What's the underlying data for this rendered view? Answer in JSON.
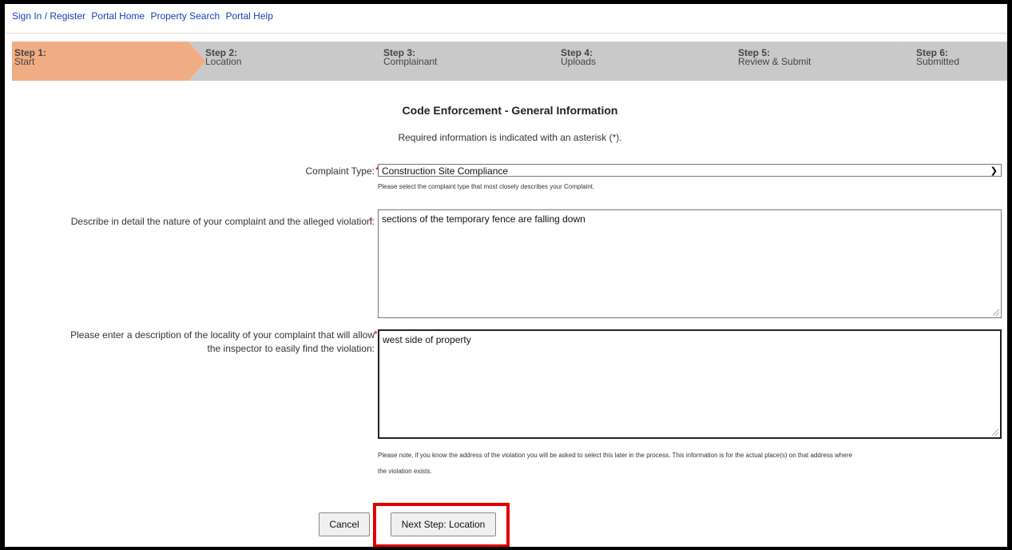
{
  "nav": {
    "links": [
      "Sign In / Register",
      "Portal Home",
      "Property Search",
      "Portal Help"
    ]
  },
  "steps": [
    {
      "num": "Step 1:",
      "name": "Start",
      "active": true
    },
    {
      "num": "Step 2:",
      "name": "Location"
    },
    {
      "num": "Step 3:",
      "name": "Complainant"
    },
    {
      "num": "Step 4:",
      "name": "Uploads"
    },
    {
      "num": "Step 5:",
      "name": "Review & Submit"
    },
    {
      "num": "Step 6:",
      "name": "Submitted"
    }
  ],
  "form": {
    "title": "Code Enforcement - General Information",
    "required_note": "Required information is indicated with an asterisk (*).",
    "complaint_type": {
      "label": "Complaint Type:",
      "value": "Construction Site Compliance",
      "hint": "Please select the complaint type that most closely describes your Complaint."
    },
    "description": {
      "label": "Describe in detail the nature of your complaint and the alleged violation:",
      "value": "sections of the temporary fence are falling down"
    },
    "locality": {
      "label_line1": "Please enter a description of the locality of your complaint that will allow",
      "label_line2": "the inspector to easily find the violation:",
      "value": "west side of property",
      "note_line1": "Please note, if you know the address of the violation you will be asked to select this later in the process. This information is for the actual place(s) on that address where",
      "note_line2": "the violation exists."
    },
    "asterisk": "*"
  },
  "buttons": {
    "cancel": "Cancel",
    "next": "Next Step: Location"
  }
}
